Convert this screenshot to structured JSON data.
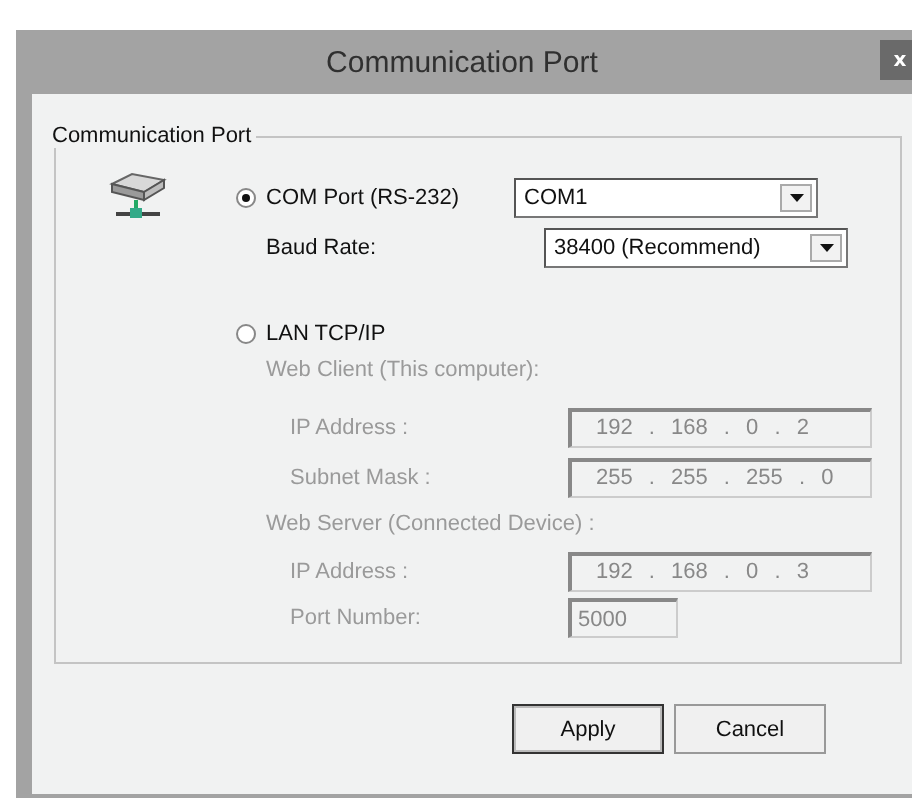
{
  "window": {
    "title": "Communication Port",
    "close": "x"
  },
  "group": {
    "label": "Communication Port"
  },
  "com": {
    "label": "COM Port (RS-232)",
    "selected": true,
    "port": "COM1",
    "baud_label": "Baud Rate:",
    "baud": "38400 (Recommend)"
  },
  "lan": {
    "label": "LAN TCP/IP",
    "selected": false,
    "disabled": true,
    "client_heading": "Web Client (This computer):",
    "client_fields": [
      {
        "label": "IP Address :",
        "value": "192 . 168 . 0 . 2"
      },
      {
        "label": "Subnet Mask :",
        "value": "255 . 255 . 255 . 0"
      }
    ],
    "server_heading": "Web Server (Connected Device) :",
    "server_ip": {
      "label": "IP Address :",
      "value": "192 . 168 . 0 . 3"
    },
    "port": {
      "label": "Port Number:",
      "value": "5000"
    }
  },
  "buttons": [
    {
      "label": "Apply",
      "default": true
    },
    {
      "label": "Cancel",
      "default": false
    }
  ]
}
